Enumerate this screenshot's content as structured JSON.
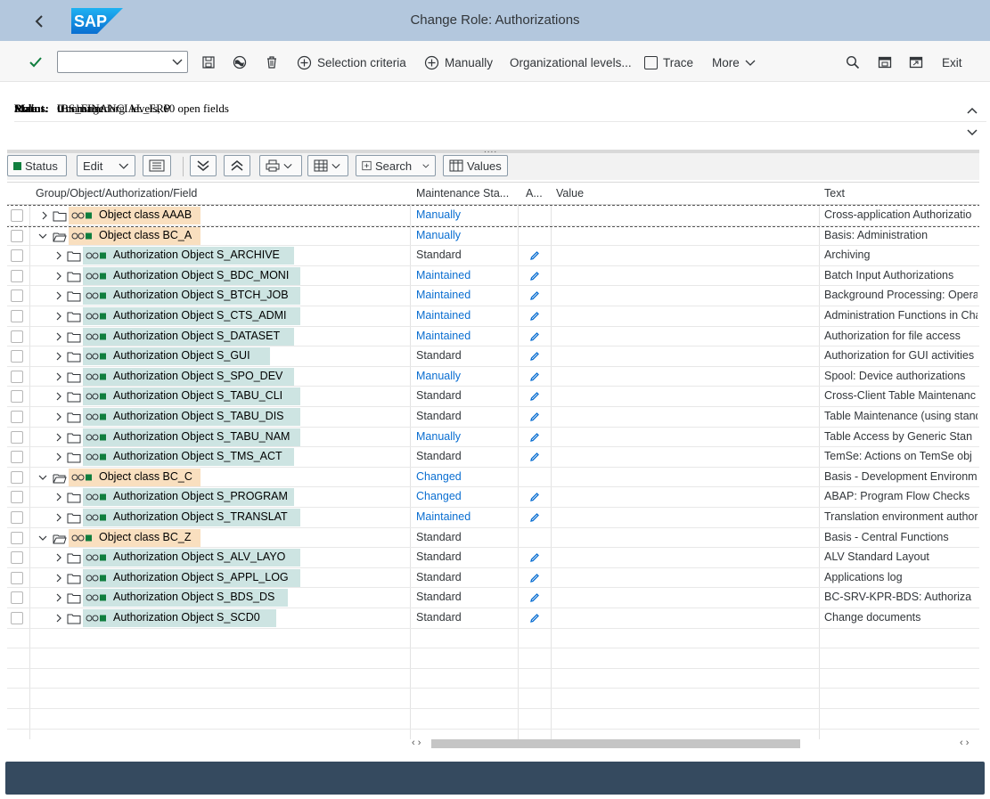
{
  "shell": {
    "title": "Change Role: Authorizations",
    "logo_text": "SAP"
  },
  "toolbar": {
    "selection_criteria": "Selection criteria",
    "manually": "Manually",
    "org_levels": "Organizational levels...",
    "trace": "Trace",
    "more": "More",
    "exit": "Exit"
  },
  "info": {
    "role_label": "Role",
    "role_value": "IBS_FINANCIAL_ERP",
    "maint_label": "Maint.",
    "maint_value": "0 unmaint. org. levels, 60 open fields",
    "status_label": "Status:",
    "status_value": "Unchanged"
  },
  "alv": {
    "status": "Status",
    "edit": "Edit",
    "search": "Search",
    "values": "Values"
  },
  "columns": [
    "Group/Object/Authorization/Field",
    "Maintenance Sta...",
    "A...",
    "Value",
    "Text"
  ],
  "rows": [
    {
      "type": "class",
      "expanded": false,
      "label": "Object class AAAB",
      "status": "Manually",
      "link": true,
      "edit": false,
      "text": "Cross-application Authorizatio"
    },
    {
      "type": "class",
      "expanded": true,
      "label": "Object class BC_A",
      "status": "Manually",
      "link": true,
      "edit": false,
      "text": "Basis: Administration"
    },
    {
      "type": "auth",
      "label": "Authorization Object S_ARCHIVE",
      "status": "Standard",
      "link": false,
      "edit": true,
      "text": "Archiving"
    },
    {
      "type": "auth",
      "label": "Authorization Object S_BDC_MONI",
      "status": "Maintained",
      "link": true,
      "edit": true,
      "text": "Batch Input Authorizations"
    },
    {
      "type": "auth",
      "label": "Authorization Object S_BTCH_JOB",
      "status": "Maintained",
      "link": true,
      "edit": true,
      "text": "Background Processing: Opera"
    },
    {
      "type": "auth",
      "label": "Authorization Object S_CTS_ADMI",
      "status": "Maintained",
      "link": true,
      "edit": true,
      "text": "Administration Functions in Cha"
    },
    {
      "type": "auth",
      "label": "Authorization Object S_DATASET",
      "status": "Maintained",
      "link": true,
      "edit": true,
      "text": "Authorization for file access"
    },
    {
      "type": "auth",
      "label": "Authorization Object S_GUI",
      "status": "Standard",
      "link": false,
      "edit": true,
      "text": "Authorization for GUI activities"
    },
    {
      "type": "auth",
      "label": "Authorization Object S_SPO_DEV",
      "status": "Manually",
      "link": true,
      "edit": true,
      "text": "Spool: Device authorizations"
    },
    {
      "type": "auth",
      "label": "Authorization Object S_TABU_CLI",
      "status": "Standard",
      "link": false,
      "edit": true,
      "text": "Cross-Client Table Maintenanc"
    },
    {
      "type": "auth",
      "label": "Authorization Object S_TABU_DIS",
      "status": "Standard",
      "link": false,
      "edit": true,
      "text": "Table Maintenance (using stand"
    },
    {
      "type": "auth",
      "label": "Authorization Object S_TABU_NAM",
      "status": "Manually",
      "link": true,
      "edit": true,
      "text": "Table Access by Generic Stan"
    },
    {
      "type": "auth",
      "label": "Authorization Object S_TMS_ACT",
      "status": "Standard",
      "link": false,
      "edit": true,
      "text": "TemSe: Actions on TemSe obj"
    },
    {
      "type": "class",
      "expanded": true,
      "label": "Object class BC_C",
      "status": "Changed",
      "link": true,
      "edit": false,
      "text": "Basis - Development Environm"
    },
    {
      "type": "auth",
      "label": "Authorization Object S_PROGRAM",
      "status": "Changed",
      "link": true,
      "edit": true,
      "text": "ABAP: Program Flow Checks"
    },
    {
      "type": "auth",
      "label": "Authorization Object S_TRANSLAT",
      "status": "Maintained",
      "link": true,
      "edit": true,
      "text": "Translation environment author"
    },
    {
      "type": "class",
      "expanded": true,
      "label": "Object class BC_Z",
      "status": "Standard",
      "link": false,
      "edit": false,
      "text": "Basis - Central Functions"
    },
    {
      "type": "auth",
      "label": "Authorization Object S_ALV_LAYO",
      "status": "Standard",
      "link": false,
      "edit": true,
      "text": "ALV Standard Layout"
    },
    {
      "type": "auth",
      "label": "Authorization Object S_APPL_LOG",
      "status": "Standard",
      "link": false,
      "edit": true,
      "text": "Applications log"
    },
    {
      "type": "auth",
      "label": "Authorization Object S_BDS_DS",
      "status": "Standard",
      "link": false,
      "edit": true,
      "text": "BC-SRV-KPR-BDS: Authoriza"
    },
    {
      "type": "auth",
      "label": "Authorization Object S_SCD0",
      "status": "Standard",
      "link": false,
      "edit": true,
      "text": "Change documents"
    }
  ],
  "colors": {
    "shell": "#b3c7dd",
    "link": "#0a6ed1",
    "class_bg": "#f9dfbf",
    "auth_bg": "#cde4e2",
    "footer": "#354a5f"
  }
}
